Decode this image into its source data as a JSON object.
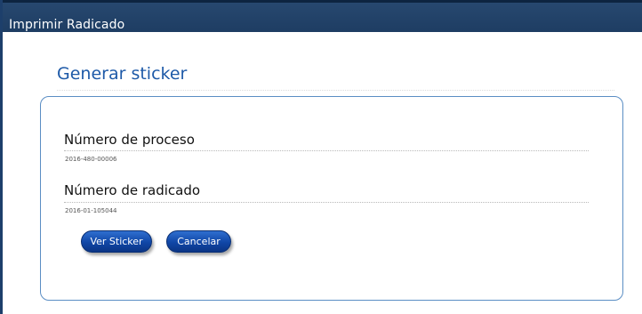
{
  "window": {
    "title": "Imprimir Radicado"
  },
  "page": {
    "title": "Generar sticker"
  },
  "form": {
    "fields": [
      {
        "label": "Número de proceso",
        "value": "2016-480-00006"
      },
      {
        "label": "Número de radicado",
        "value": "2016-01-105044"
      }
    ]
  },
  "actions": {
    "view_label": "Ver Sticker",
    "cancel_label": "Cancelar"
  },
  "colors": {
    "titlebar": "#1e3d63",
    "accent": "#1e5aa8",
    "button": "#1046a6",
    "panel_border": "#5b8ec4"
  }
}
